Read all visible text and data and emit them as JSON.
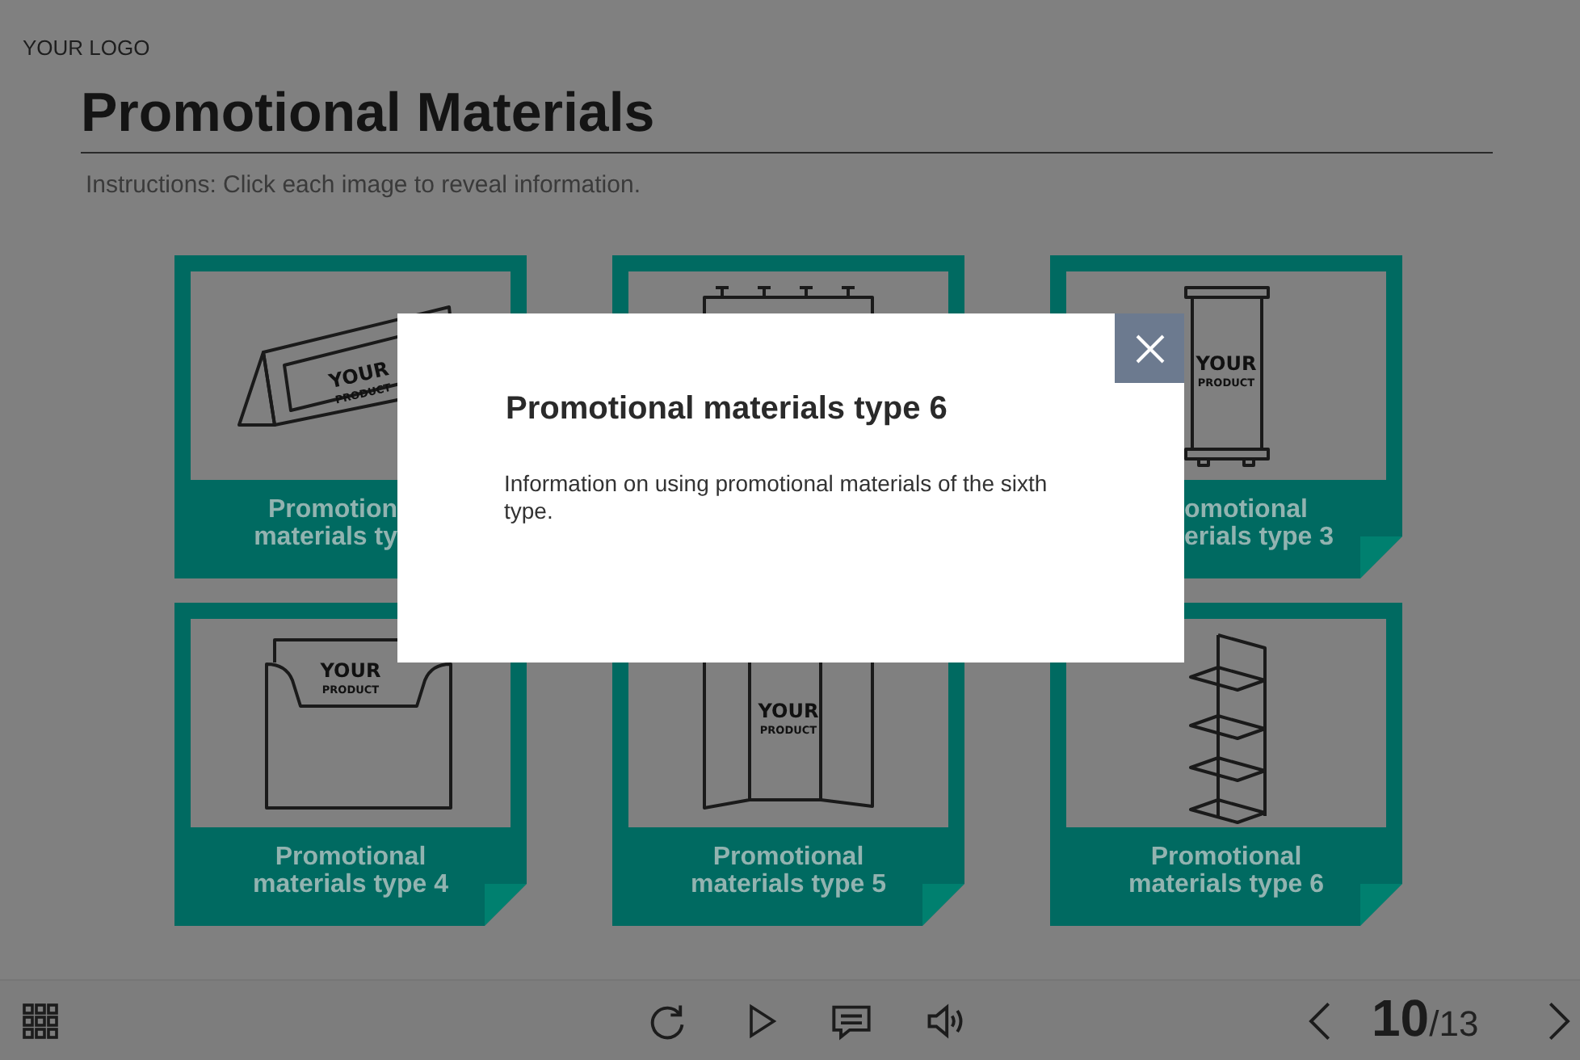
{
  "header": {
    "logo": "YOUR LOGO",
    "title": "Promotional Materials",
    "instructions": "Instructions: Click each image to reveal information."
  },
  "cards": [
    {
      "kind": "tent-card",
      "sign": [
        "YOUR",
        "PRODUCT"
      ],
      "title_lines": [
        "Promotion",
        "materials ty"
      ]
    },
    {
      "kind": "banner-stand"
    },
    {
      "kind": "roll-up",
      "sign": [
        "YOUR",
        "PRODUCT"
      ],
      "title_lines": [
        "omotional",
        "erials type 3"
      ]
    },
    {
      "kind": "brochure-holder",
      "sign": [
        "YOUR",
        "PRODUCT"
      ],
      "title_lines": [
        "Promotional",
        "materials type 4"
      ]
    },
    {
      "kind": "folding-screen",
      "sign": [
        "YOUR",
        "PRODUCT"
      ],
      "title_lines": [
        "Promotional",
        "materials type 5"
      ]
    },
    {
      "kind": "shelf-stand",
      "title_lines": [
        "Promotional",
        "materials type 6"
      ]
    }
  ],
  "modal": {
    "title": "Promotional materials type 6",
    "body": "Information on using promotional materials of the sixth type."
  },
  "footer": {
    "current": "10",
    "total": "/13"
  }
}
